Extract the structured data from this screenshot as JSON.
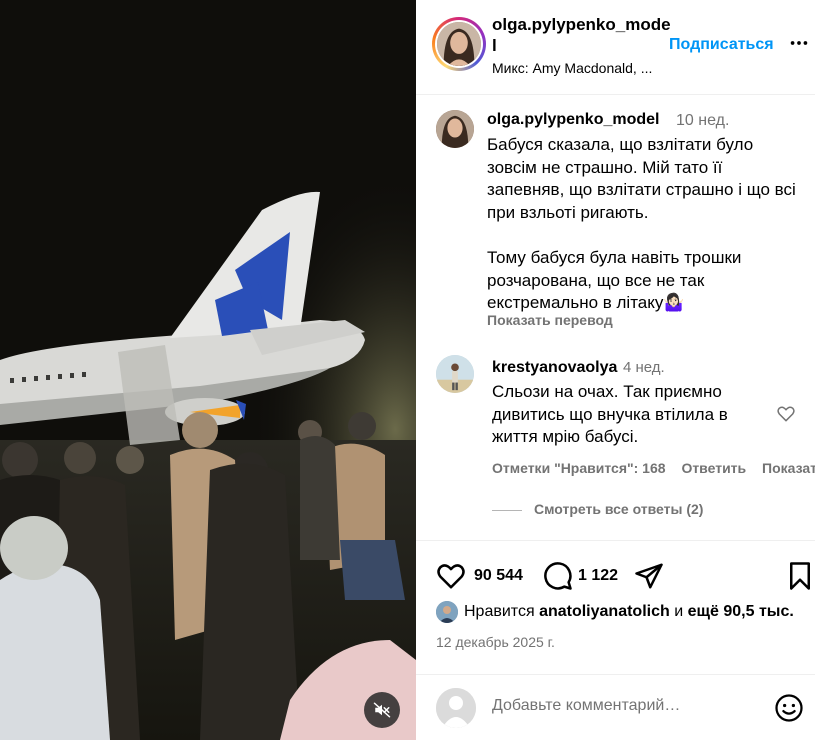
{
  "video": {
    "mute_icon": "muted-speaker-icon"
  },
  "header": {
    "username": "olga.pylypenko_model",
    "subscribe_label": "Подписаться",
    "music": "Микс: Amy Macdonald, ...",
    "more_icon": "more-dots-icon",
    "story_ring_colors": [
      "#feda75",
      "#fa7e1e",
      "#d62976",
      "#962fbf",
      "#4f5bd5"
    ]
  },
  "caption": {
    "username": "olga.pylypenko_model",
    "time": "10 нед.",
    "text": "Бабуся сказала, що взлітати було зовсім не страшно. Мій тато її запевняв, що взлітати страшно і що всі при взльоті ригають.\n\nТому бабуся була навіть трошки розчарована, що все не так екстремально в літаку🤷🏻‍♀️",
    "translate_label": "Показать перевод"
  },
  "reply": {
    "username": "krestyanovaolya",
    "time": "4 нед.",
    "text": "Сльози на очах. Так приємно дивитись що внучка втілила в життя мрію бабусі.",
    "likes_label": "Отметки \"Нравится\": 168",
    "reply_label": "Ответить",
    "translate_label": "Показать перевод",
    "view_replies_label": "Смотреть все ответы (2)"
  },
  "actions": {
    "likes_count": "90 544",
    "comments_count": "1 122",
    "icons": [
      "heart-icon",
      "comment-bubble-icon",
      "share-paper-plane-icon",
      "bookmark-icon"
    ]
  },
  "liked_by": {
    "prefix": "Нравится",
    "user": "anatoliyanatolich",
    "conj": "и",
    "rest": "ещё 90,5 тыс."
  },
  "date": "12 декабрь 2025 г.",
  "add_comment": {
    "placeholder": "Добавьте комментарий…",
    "emoji_icon": "smiley-icon"
  },
  "colors": {
    "link_blue": "#0095f6",
    "secondary_text": "#737373",
    "divider": "#efefef"
  }
}
